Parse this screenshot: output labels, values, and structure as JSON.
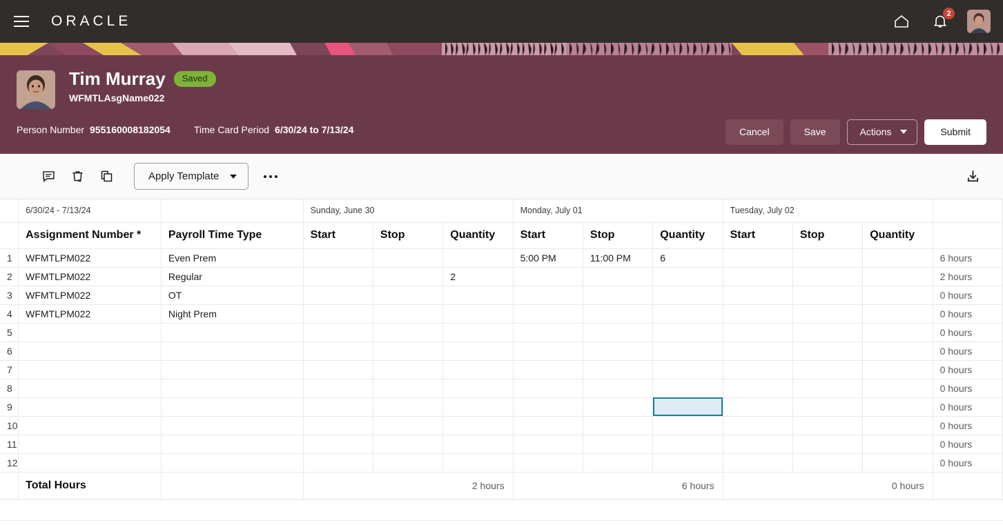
{
  "globalnav": {
    "menu_icon": "hamburger-menu-icon",
    "brand": "ORACLE",
    "home_icon": "home-icon",
    "notifications_icon": "bell-icon",
    "notification_count": "2",
    "avatar_icon": "user-avatar"
  },
  "header": {
    "person_name": "Tim Murray",
    "status_badge": "Saved",
    "assignment_name": "WFMTLAsgName022",
    "person_number_label": "Person Number",
    "person_number_value": "955160008182054",
    "time_card_period_label": "Time Card Period",
    "time_card_period_value": "6/30/24 to 7/13/24",
    "buttons": {
      "cancel": "Cancel",
      "save": "Save",
      "actions": "Actions",
      "submit": "Submit"
    }
  },
  "toolbar": {
    "comment_icon": "comment-icon",
    "delete_icon": "delete-row-icon",
    "duplicate_icon": "duplicate-row-icon",
    "apply_template": "Apply Template",
    "overflow": "more-actions",
    "download_icon": "download-icon"
  },
  "grid": {
    "period_label": "6/30/24 - 7/13/24",
    "col_assignment": "Assignment Number *",
    "col_payroll_time_type": "Payroll Time Type",
    "col_start": "Start",
    "col_stop": "Stop",
    "col_quantity": "Quantity",
    "days": [
      {
        "label": "Sunday, June 30"
      },
      {
        "label": "Monday, July 01"
      },
      {
        "label": "Tuesday, July 02"
      }
    ],
    "rows": [
      {
        "num": "1",
        "assignment": "WFMTLPM022",
        "time_type": "Even Prem",
        "sun_start": "",
        "sun_stop": "",
        "sun_qty": "",
        "mon_start": "5:00 PM",
        "mon_stop": "11:00 PM",
        "mon_qty": "6",
        "tue_start": "",
        "tue_stop": "",
        "tue_qty": "",
        "total": "6 hours"
      },
      {
        "num": "2",
        "assignment": "WFMTLPM022",
        "time_type": "Regular",
        "sun_start": "",
        "sun_stop": "",
        "sun_qty": "2",
        "mon_start": "",
        "mon_stop": "",
        "mon_qty": "",
        "tue_start": "",
        "tue_stop": "",
        "tue_qty": "",
        "total": "2 hours"
      },
      {
        "num": "3",
        "assignment": "WFMTLPM022",
        "time_type": "OT",
        "sun_start": "",
        "sun_stop": "",
        "sun_qty": "",
        "mon_start": "",
        "mon_stop": "",
        "mon_qty": "",
        "tue_start": "",
        "tue_stop": "",
        "tue_qty": "",
        "total": "0 hours"
      },
      {
        "num": "4",
        "assignment": "WFMTLPM022",
        "time_type": "Night Prem",
        "sun_start": "",
        "sun_stop": "",
        "sun_qty": "",
        "mon_start": "",
        "mon_stop": "",
        "mon_qty": "",
        "tue_start": "",
        "tue_stop": "",
        "tue_qty": "",
        "total": "0 hours"
      },
      {
        "num": "5",
        "assignment": "",
        "time_type": "",
        "sun_start": "",
        "sun_stop": "",
        "sun_qty": "",
        "mon_start": "",
        "mon_stop": "",
        "mon_qty": "",
        "tue_start": "",
        "tue_stop": "",
        "tue_qty": "",
        "total": "0 hours"
      },
      {
        "num": "6",
        "assignment": "",
        "time_type": "",
        "sun_start": "",
        "sun_stop": "",
        "sun_qty": "",
        "mon_start": "",
        "mon_stop": "",
        "mon_qty": "",
        "tue_start": "",
        "tue_stop": "",
        "tue_qty": "",
        "total": "0 hours"
      },
      {
        "num": "7",
        "assignment": "",
        "time_type": "",
        "sun_start": "",
        "sun_stop": "",
        "sun_qty": "",
        "mon_start": "",
        "mon_stop": "",
        "mon_qty": "",
        "tue_start": "",
        "tue_stop": "",
        "tue_qty": "",
        "total": "0 hours"
      },
      {
        "num": "8",
        "assignment": "",
        "time_type": "",
        "sun_start": "",
        "sun_stop": "",
        "sun_qty": "",
        "mon_start": "",
        "mon_stop": "",
        "mon_qty": "",
        "tue_start": "",
        "tue_stop": "",
        "tue_qty": "",
        "total": "0 hours"
      },
      {
        "num": "9",
        "assignment": "",
        "time_type": "",
        "sun_start": "",
        "sun_stop": "",
        "sun_qty": "",
        "mon_start": "",
        "mon_stop": "",
        "mon_qty": "",
        "tue_start": "",
        "tue_stop": "",
        "tue_qty": "",
        "total": "0 hours",
        "selected_cell": "mon_qty"
      },
      {
        "num": "10",
        "assignment": "",
        "time_type": "",
        "sun_start": "",
        "sun_stop": "",
        "sun_qty": "",
        "mon_start": "",
        "mon_stop": "",
        "mon_qty": "",
        "tue_start": "",
        "tue_stop": "",
        "tue_qty": "",
        "total": "0 hours"
      },
      {
        "num": "11",
        "assignment": "",
        "time_type": "",
        "sun_start": "",
        "sun_stop": "",
        "sun_qty": "",
        "mon_start": "",
        "mon_stop": "",
        "mon_qty": "",
        "tue_start": "",
        "tue_stop": "",
        "tue_qty": "",
        "total": "0 hours"
      },
      {
        "num": "12",
        "assignment": "",
        "time_type": "",
        "sun_start": "",
        "sun_stop": "",
        "sun_qty": "",
        "mon_start": "",
        "mon_stop": "",
        "mon_qty": "",
        "tue_start": "",
        "tue_stop": "",
        "tue_qty": "",
        "total": "0 hours"
      }
    ],
    "total_row": {
      "label": "Total Hours",
      "sun_total": "2 hours",
      "mon_total": "6 hours",
      "tue_total": "0 hours"
    }
  },
  "colors": {
    "nav_bg": "#312d2b",
    "header_bg": "#6b3a4a",
    "badge_green": "#7db338",
    "badge_red": "#c74634",
    "selection_border": "#1a7f92",
    "selection_fill": "#dfecf4"
  }
}
